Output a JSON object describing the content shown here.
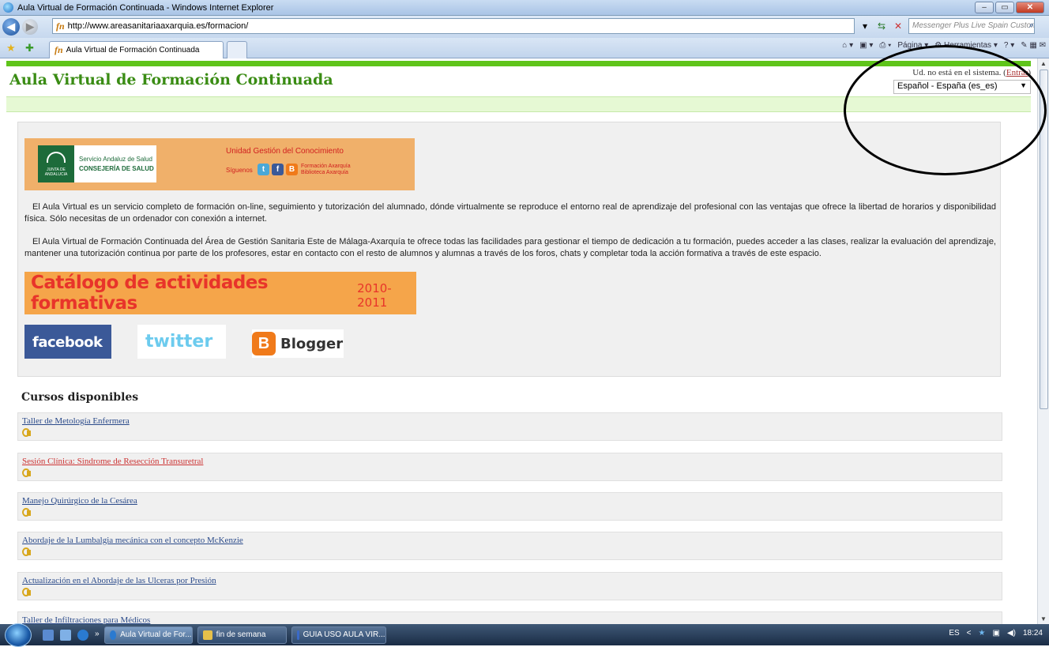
{
  "window": {
    "title": "Aula Virtual de Formación Continuada - Windows Internet Explorer",
    "min": "–",
    "max": "▭",
    "close": "✕"
  },
  "address": {
    "url": "http://www.areasanitariaaxarquia.es/formacion/",
    "search_placeholder": "Messenger Plus Live Spain Customiz"
  },
  "tabs": [
    {
      "label": "Aula Virtual de Formación Continuada"
    }
  ],
  "command_bar": {
    "page_label": "Página",
    "tools_label": "Herramientas"
  },
  "header": {
    "title": "Aula Virtual de Formación Continuada",
    "login_text": "Ud. no está en el sistema.",
    "login_link": "Entrar",
    "language": "Español - España (es_es)"
  },
  "banner": {
    "org_line1": "Servicio Andaluz de Salud",
    "org_line2": "CONSEJERÍA DE SALUD",
    "logo_caption": "JUNTA DE ANDALUCIA",
    "unit": "Unidad Gestión del Conocimiento",
    "follow": "Síguenos",
    "links_line1": "Formación Axarquía",
    "links_line2": "Biblioteca Axarquía"
  },
  "intro": {
    "p1": "El Aula Virtual es un servicio completo de formación on-line, seguimiento y tutorización del alumnado, dónde virtualmente se reproduce el entorno real de aprendizaje del profesional con las ventajas que ofrece la libertad de horarios y disponibilidad física. Sólo necesitas de un ordenador con conexión a internet.",
    "p2": "El Aula Virtual de Formación Continuada del Área de Gestión Sanitaria Este de Málaga-Axarquía te ofrece todas las facilidades para gestionar el tiempo de dedicación a tu formación, puedes acceder a las clases, realizar la evaluación del aprendizaje, mantener una tutorización continua por parte de los profesores, estar en contacto con el resto de alumnos y alumnas a través de los foros, chats y completar toda la acción formativa a través de este espacio."
  },
  "catalog": {
    "title": "Catálogo de actividades formativas",
    "years": "2010-2011"
  },
  "social": {
    "facebook": "facebook",
    "twitter": "twitter",
    "blogger": "Blogger"
  },
  "courses": {
    "heading": "Cursos disponibles",
    "items": [
      {
        "label": "Taller de Metología Enfermera"
      },
      {
        "label": "Sesión Clínica: Sindrome de Resección Transuretral"
      },
      {
        "label": "Manejo Quirúrgico de la Cesárea"
      },
      {
        "label": "Abordaje de la Lumbalgia mecánica con el concepto McKenzie"
      },
      {
        "label": "Actualización en el Abordaje de las Ulceras por Presión"
      },
      {
        "label": "Taller de Infiltraciones para Médicos"
      }
    ]
  },
  "taskbar": {
    "items": [
      {
        "label": "Aula Virtual de For..."
      },
      {
        "label": "fin de semana"
      },
      {
        "label": "GUIA USO AULA VIR..."
      }
    ],
    "lang": "ES",
    "time": "18:24"
  },
  "colors": {
    "site_green": "#3a8c14",
    "green_bar": "#5fc41a",
    "banner_orange": "#f0b06a",
    "link_blue": "#2a4a8a",
    "visited_red": "#c33"
  }
}
